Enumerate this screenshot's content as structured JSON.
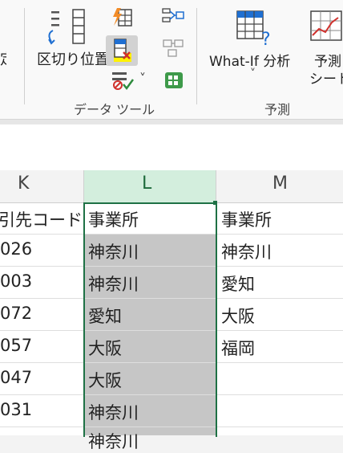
{
  "ribbon": {
    "edge_label_partial": "定",
    "text_to_columns_label": "区切り位置",
    "what_if_label": "What-If 分析",
    "what_if_chevron": "˅",
    "forecast_label_line1": "予測",
    "forecast_label_line2": "シート",
    "group_data_tools": "データ ツール",
    "group_forecast": "予測",
    "small_chevron": "˅"
  },
  "columns": {
    "k": "K",
    "l": "L",
    "m": "M"
  },
  "rows": [
    {
      "k": "引先コード",
      "l": "事業所",
      "m": "事業所"
    },
    {
      "k": "026",
      "l": "神奈川",
      "m": "神奈川"
    },
    {
      "k": "003",
      "l": "神奈川",
      "m": "愛知"
    },
    {
      "k": "072",
      "l": "愛知",
      "m": "大阪"
    },
    {
      "k": "057",
      "l": "大阪",
      "m": "福岡"
    },
    {
      "k": "047",
      "l": "大阪",
      "m": ""
    },
    {
      "k": "031",
      "l": "神奈川",
      "m": ""
    },
    {
      "k": "",
      "l": "神奈川",
      "m": ""
    }
  ]
}
